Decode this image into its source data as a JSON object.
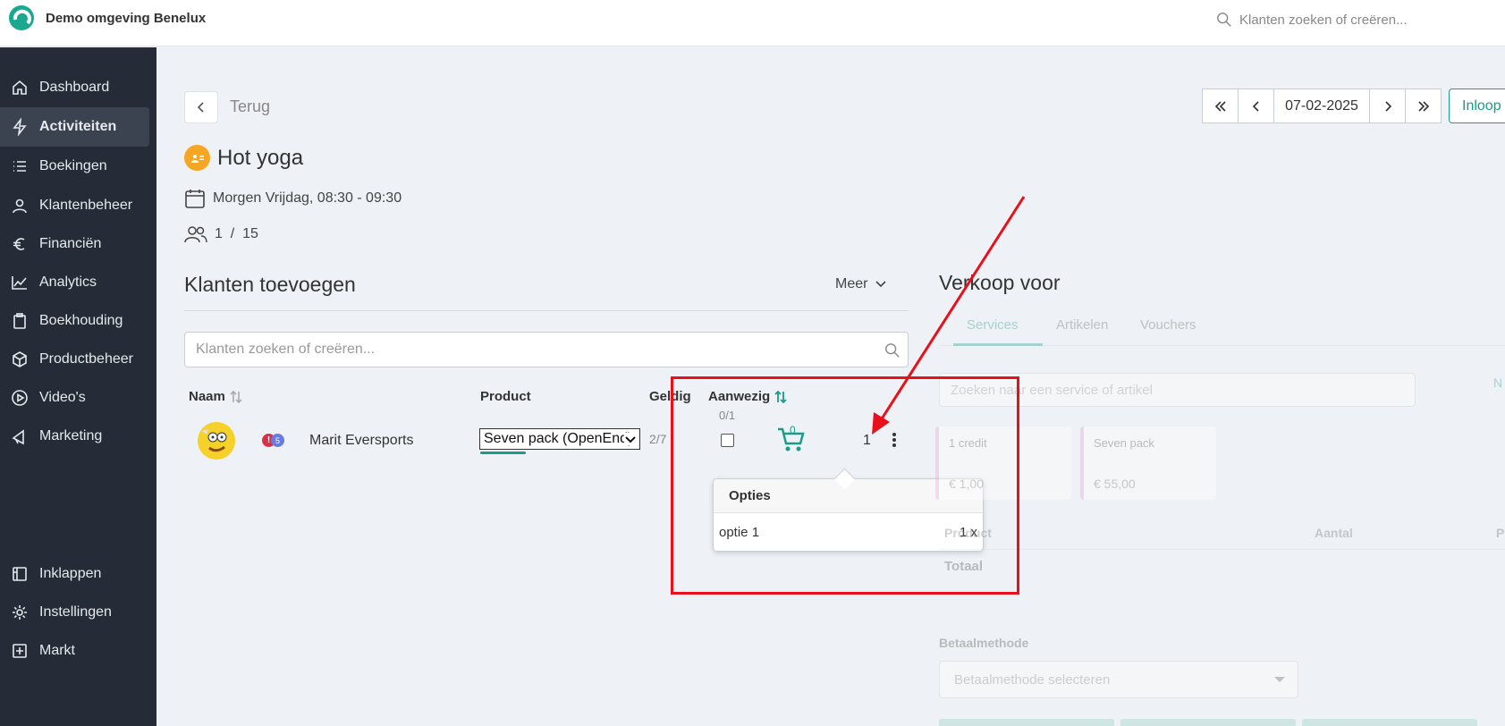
{
  "app": {
    "brand": "Demo omgeving Benelux",
    "search_placeholder": "Klanten zoeken of creëren..."
  },
  "sidebar": {
    "items": [
      {
        "label": "Dashboard",
        "icon": "home-icon"
      },
      {
        "label": "Activiteiten",
        "icon": "bolt-icon",
        "active": true
      },
      {
        "label": "Boekingen",
        "icon": "list-icon"
      },
      {
        "label": "Klantenbeheer",
        "icon": "user-icon"
      },
      {
        "label": "Financiën",
        "icon": "euro-icon"
      },
      {
        "label": "Analytics",
        "icon": "chart-line-icon"
      },
      {
        "label": "Boekhouding",
        "icon": "clipboard-icon"
      },
      {
        "label": "Productbeheer",
        "icon": "box-icon"
      },
      {
        "label": "Video's",
        "icon": "play-icon"
      },
      {
        "label": "Marketing",
        "icon": "megaphone-icon"
      }
    ],
    "bottom_items": [
      {
        "label": "Inklappen",
        "icon": "collapse-icon"
      },
      {
        "label": "Instellingen",
        "icon": "gear-icon"
      },
      {
        "label": "Markt",
        "icon": "plus-square-icon"
      }
    ]
  },
  "header": {
    "back_label": "Terug",
    "date": "07-02-2025",
    "inloop_label": "Inloop"
  },
  "activity": {
    "title": "Hot yoga",
    "time": "Morgen Vrijdag, 08:30 - 09:30",
    "count": "1  /  15"
  },
  "customers": {
    "title": "Klanten toevoegen",
    "more_label": "Meer",
    "search_placeholder": "Klanten zoeken of creëren...",
    "columns": {
      "name": "Naam",
      "product": "Product",
      "valid": "Geldig",
      "present": "Aanwezig"
    },
    "row": {
      "name": "Marit Eversports",
      "badge_alert": "!",
      "badge_num": "5",
      "product": "Seven pack (OpenEnd)",
      "valid": "2/7",
      "present": "0/1",
      "cart_count": "0",
      "quantity": "1"
    },
    "options_popover": {
      "title": "Opties",
      "items": [
        {
          "label": "optie 1",
          "qty": "1 x"
        }
      ]
    }
  },
  "sales": {
    "title": "Verkoop voor",
    "tabs": [
      "Services",
      "Artikelen",
      "Vouchers"
    ],
    "search_placeholder": "Zoeken naar een service of artikel",
    "n_label": "N",
    "cards": [
      {
        "title": "1 credit",
        "price": "€ 1,00"
      },
      {
        "title": "Seven pack",
        "price": "€ 55,00"
      }
    ],
    "table_headers": [
      "Product",
      "Aantal",
      "P"
    ],
    "total_label": "Totaal",
    "payment_label": "Betaalmethode",
    "payment_placeholder": "Betaalmethode selecteren"
  },
  "colors": {
    "accent": "#1a9c8a",
    "sidebar_bg": "#262c37",
    "annotation_red": "#e8101a",
    "activity_badge": "#f5a623"
  }
}
